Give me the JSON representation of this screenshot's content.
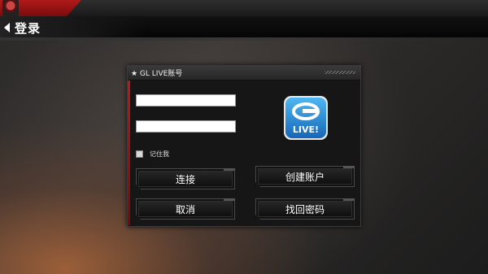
{
  "header": {
    "back_icon": "chevron-left-icon",
    "title": "登录"
  },
  "dialog": {
    "title": "★ GL LIVE账号",
    "username_value": "",
    "password_value": "",
    "remember_label": "记住我",
    "remember_checked": false,
    "logo_icon": "gameloft-live-logo",
    "logo_text": "LIVE!",
    "buttons": {
      "connect": "连接",
      "create_account": "创建账户",
      "cancel": "取消",
      "recover_password": "找回密码"
    }
  },
  "colors": {
    "accent_red": "#c01818",
    "logo_blue": "#1e8fd6",
    "dialog_bg": "#161616"
  }
}
